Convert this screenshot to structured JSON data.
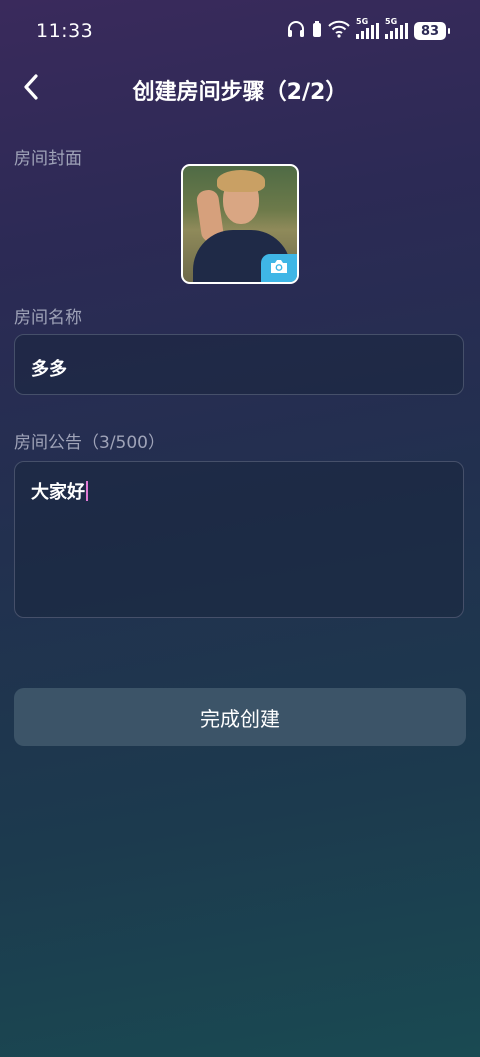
{
  "status_bar": {
    "time": "11:33",
    "signal1_label": "5G",
    "signal2_label": "5G",
    "battery": "83",
    "icons": [
      "headphones-icon",
      "battery-saver-icon",
      "wifi-icon",
      "signal-icon",
      "signal-icon",
      "battery-icon"
    ]
  },
  "header": {
    "title": "创建房间步骤（2/2）",
    "back_icon": "chevron-left-icon"
  },
  "cover": {
    "label": "房间封面",
    "camera_icon": "camera-icon"
  },
  "room_name": {
    "label": "房间名称",
    "value": "多多"
  },
  "announcement": {
    "label": "房间公告（3/500）",
    "value": "大家好"
  },
  "submit": {
    "label": "完成创建"
  },
  "colors": {
    "accent_camera": "#3fb6e6",
    "button_bg": "#3c5468",
    "caret": "#e07ad5"
  }
}
